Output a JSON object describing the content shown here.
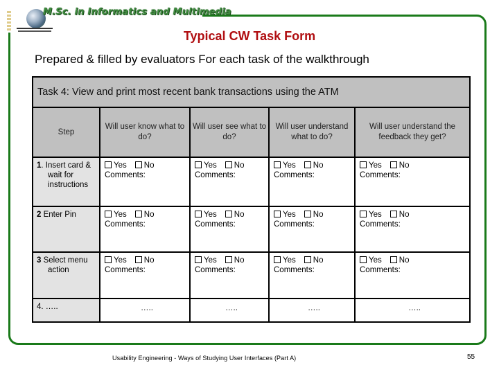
{
  "header": {
    "brand": "M.Sc. in Informatics and Multimedia",
    "logo": "globe-logo-icon"
  },
  "title": "Typical CW Task Form",
  "subtitle": "Prepared & filled by evaluators For each task of the walkthrough",
  "form": {
    "task": "Task 4: View and print  most recent bank transactions using the ATM",
    "columns": [
      "Step",
      "Will user know what to do?",
      "Will user see what to do?",
      "Will user understand what to do?",
      "Will user understand  the feedback they get?"
    ],
    "rows": [
      {
        "num": "1",
        "step_rest": ". Insert card &",
        "step_line2": "wait for",
        "step_line3": "instructions"
      },
      {
        "num": "2",
        "step_rest": " Enter Pin"
      },
      {
        "num": "3",
        "step_rest": " Select menu",
        "step_line2": "action"
      },
      {
        "num": "",
        "step_rest": "4. ….."
      }
    ],
    "yes_label": "Yes",
    "no_label": "No",
    "comments_label": "Comments:",
    "ellipsis": "….."
  },
  "footer": {
    "text": "Usability Engineering  -  Ways of Studying User Interfaces (Part A)",
    "page": "55"
  },
  "colors": {
    "frame": "#1a7a1a",
    "title": "#b00d10",
    "header_fill": "#c0c0c0",
    "step_fill": "#e3e3e3"
  }
}
